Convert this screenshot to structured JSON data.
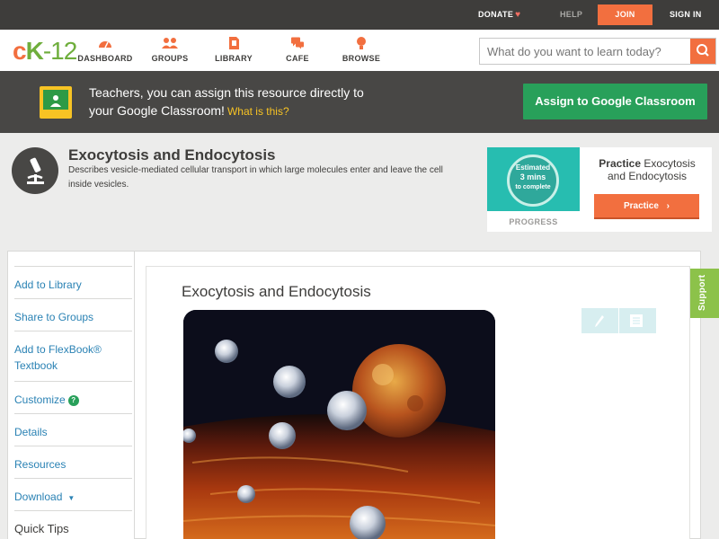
{
  "topbar": {
    "donate": "DONATE",
    "help": "HELP",
    "join": "JOIN",
    "signin": "SIGN IN"
  },
  "logo": {
    "part1": "c",
    "part2": "K",
    "part3": "-12"
  },
  "nav": [
    {
      "label": "DASHBOARD",
      "icon": "dashboard-icon"
    },
    {
      "label": "GROUPS",
      "icon": "groups-icon"
    },
    {
      "label": "LIBRARY",
      "icon": "library-icon"
    },
    {
      "label": "CAFE",
      "icon": "cafe-icon"
    },
    {
      "label": "BROWSE",
      "icon": "browse-icon"
    }
  ],
  "search": {
    "placeholder": "What do you want to learn today?",
    "icon": "search-icon"
  },
  "banner": {
    "line1": "Teachers, you can assign this resource directly to",
    "line2": "your Google Classroom!",
    "link": "What is this?",
    "button": "Assign to Google Classroom"
  },
  "concept": {
    "title": "Exocytosis and Endocytosis",
    "description": "Describes vesicle-mediated cellular transport in which large molecules enter and leave the cell inside vesicles."
  },
  "practice": {
    "estimate_line1": "Estimated",
    "estimate_line2": "3 mins",
    "estimate_line3": "to complete",
    "progress_label": "PROGRESS",
    "heading_bold": "Practice",
    "heading_rest": "Exocytosis and Endocytosis",
    "button": "Practice"
  },
  "sidebar": {
    "items": [
      "Add to Library",
      "Share to Groups",
      "Add to FlexBook® Textbook",
      "Customize",
      "Details",
      "Resources",
      "Download"
    ],
    "quick_tips": "Quick Tips"
  },
  "content": {
    "title": "Exocytosis and Endocytosis"
  },
  "support": "Support",
  "colors": {
    "accent": "#f26f3f",
    "green": "#28a05a",
    "link": "#2a82b4",
    "support": "#8cc24a"
  }
}
